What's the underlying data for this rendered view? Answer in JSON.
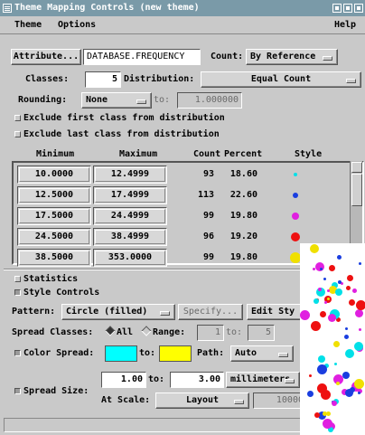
{
  "window": {
    "title": "Theme Mapping Controls (new theme)"
  },
  "menubar": {
    "theme": "Theme",
    "options": "Options",
    "help": "Help"
  },
  "attribute": {
    "button": "Attribute...",
    "field": "DATABASE.FREQUENCY",
    "count_label": "Count:",
    "count_value": "By Reference"
  },
  "classes": {
    "label": "Classes:",
    "value": "5",
    "distribution_label": "Distribution:",
    "distribution_value": "Equal Count"
  },
  "rounding": {
    "label": "Rounding:",
    "value": "None",
    "to_label": "to:",
    "to_value": "1.000000"
  },
  "options": {
    "exclude_first": "Exclude first class from distribution",
    "exclude_last": "Exclude last class from distribution"
  },
  "table": {
    "headers": {
      "min": "Minimum",
      "max": "Maximum",
      "count": "Count",
      "percent": "Percent",
      "style": "Style"
    },
    "rows": [
      {
        "min": "10.0000",
        "max": "12.4999",
        "count": "93",
        "percent": "18.60",
        "color": "#00e0e8",
        "size": 4
      },
      {
        "min": "12.5000",
        "max": "17.4999",
        "count": "113",
        "percent": "22.60",
        "color": "#1a3ee0",
        "size": 6
      },
      {
        "min": "17.5000",
        "max": "24.4999",
        "count": "99",
        "percent": "19.80",
        "color": "#e020e0",
        "size": 8
      },
      {
        "min": "24.5000",
        "max": "38.4999",
        "count": "96",
        "percent": "19.20",
        "color": "#ee1010",
        "size": 10
      },
      {
        "min": "38.5000",
        "max": "353.0000",
        "count": "99",
        "percent": "19.80",
        "color": "#f0e000",
        "size": 12
      }
    ]
  },
  "toggles": {
    "statistics": "Statistics",
    "style_controls": "Style Controls"
  },
  "pattern": {
    "label": "Pattern:",
    "value": "Circle (filled)",
    "specify": "Specify...",
    "edit": "Edit Sty"
  },
  "spread_classes": {
    "label": "Spread Classes:",
    "all": "All",
    "range": "Range:",
    "from_value": "1",
    "to_label": "to:",
    "to_value": "5"
  },
  "color_spread": {
    "label": "Color Spread:",
    "from_color": "#00ffff",
    "to_label": "to:",
    "to_color": "#ffff00",
    "path_label": "Path:",
    "path_value": "Auto"
  },
  "spread_size": {
    "label": "Spread Size:",
    "from_value": "1.00",
    "to_label": "to:",
    "to_value": "3.00",
    "units": "millimeters",
    "scale_label": "At Scale:",
    "scale_value": "Layout",
    "scale_number": "10000"
  }
}
